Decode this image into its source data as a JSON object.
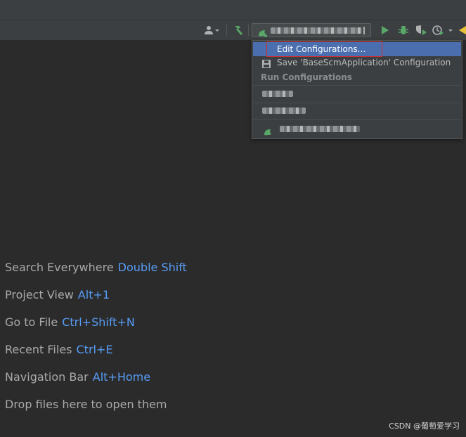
{
  "toolbar": {
    "icons": [
      "user-dropdown-icon",
      "build-hammer-icon",
      "run-icon",
      "debug-icon",
      "coverage-icon",
      "profile-icon",
      "vcs-update-icon"
    ]
  },
  "menu": {
    "edit_configurations": "Edit Configurations...",
    "save_configuration": "Save 'BaseScmApplication' Configuration",
    "run_configurations_header": "Run Configurations"
  },
  "hints": [
    {
      "label": "Search Everywhere",
      "key": "Double Shift"
    },
    {
      "label": "Project View",
      "key": "Alt+1"
    },
    {
      "label": "Go to File",
      "key": "Ctrl+Shift+N"
    },
    {
      "label": "Recent Files",
      "key": "Ctrl+E"
    },
    {
      "label": "Navigation Bar",
      "key": "Alt+Home"
    }
  ],
  "drop_hint": "Drop files here to open them",
  "watermark": "CSDN @葡萄爱学习",
  "colors": {
    "background": "#2b2b2b",
    "toolbar": "#3c3f41",
    "selection": "#4b6eaf",
    "shortcut": "#589df6",
    "run_green": "#59a869",
    "highlight_red": "#d22c2c"
  }
}
